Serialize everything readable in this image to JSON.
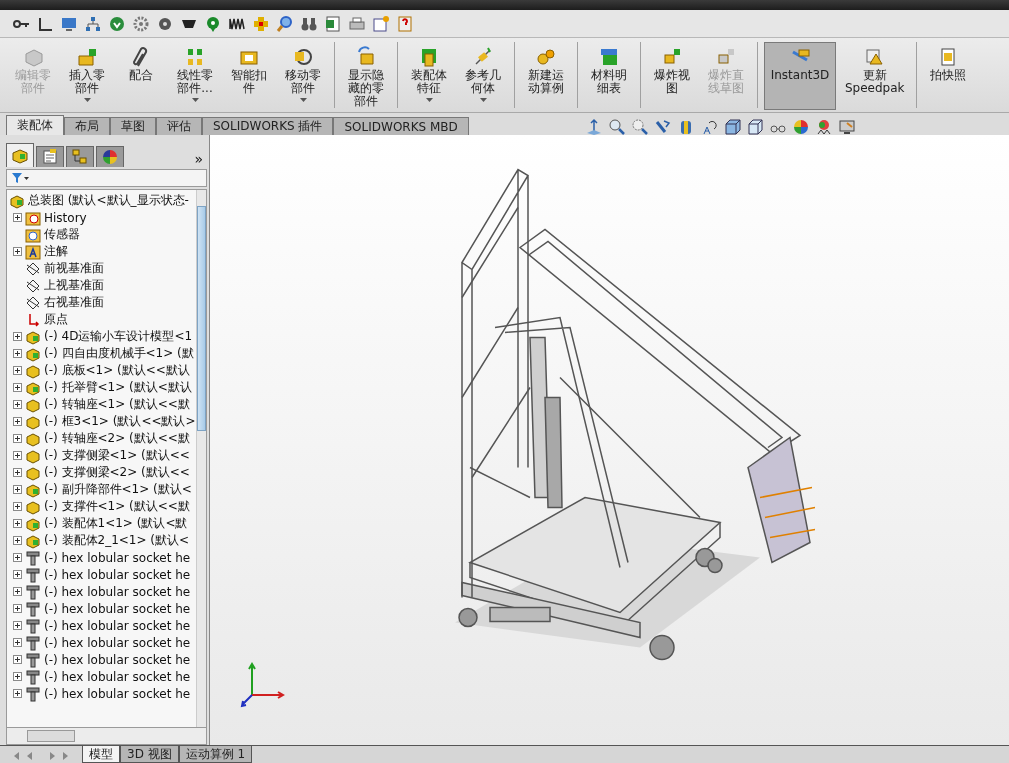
{
  "ribbon": {
    "groups": [
      [
        {
          "label": "编辑零部件",
          "disabled": true,
          "dropdown": false,
          "selected": false
        },
        {
          "label": "插入零部件",
          "disabled": false,
          "dropdown": true,
          "selected": false
        },
        {
          "label": "配合",
          "disabled": false,
          "dropdown": false,
          "selected": false
        },
        {
          "label": "线性零部件...",
          "disabled": false,
          "dropdown": true,
          "selected": false
        },
        {
          "label": "智能扣件",
          "disabled": false,
          "dropdown": false,
          "selected": false
        },
        {
          "label": "移动零部件",
          "disabled": false,
          "dropdown": true,
          "selected": false
        }
      ],
      [
        {
          "label": "显示隐藏的零部件",
          "disabled": false,
          "dropdown": false,
          "selected": false
        }
      ],
      [
        {
          "label": "装配体特征",
          "disabled": false,
          "dropdown": true,
          "selected": false
        },
        {
          "label": "参考几何体",
          "disabled": false,
          "dropdown": true,
          "selected": false
        }
      ],
      [
        {
          "label": "新建运动算例",
          "disabled": false,
          "dropdown": false,
          "selected": false
        }
      ],
      [
        {
          "label": "材料明细表",
          "disabled": false,
          "dropdown": false,
          "selected": false
        }
      ],
      [
        {
          "label": "爆炸视图",
          "disabled": false,
          "dropdown": false,
          "selected": false
        },
        {
          "label": "爆炸直线草图",
          "disabled": true,
          "dropdown": false,
          "selected": false
        }
      ],
      [
        {
          "label": "Instant3D",
          "disabled": false,
          "dropdown": false,
          "selected": true
        },
        {
          "label": "更新 Speedpak",
          "disabled": false,
          "dropdown": false,
          "selected": false
        }
      ],
      [
        {
          "label": "拍快照",
          "disabled": false,
          "dropdown": false,
          "selected": false
        }
      ]
    ]
  },
  "tabs": [
    {
      "label": "装配体",
      "selected": true
    },
    {
      "label": "布局",
      "selected": false
    },
    {
      "label": "草图",
      "selected": false
    },
    {
      "label": "评估",
      "selected": false
    },
    {
      "label": "SOLIDWORKS 插件",
      "selected": false
    },
    {
      "label": "SOLIDWORKS MBD",
      "selected": false
    }
  ],
  "panel": {
    "tabs": [
      {
        "selected": true
      },
      {
        "selected": false
      },
      {
        "selected": false
      },
      {
        "selected": false
      }
    ],
    "more": "»"
  },
  "tree": {
    "root": {
      "label": "总装图 (默认<默认_显示状态-",
      "kind": "assembly",
      "children": [
        {
          "label": "History",
          "kind": "history",
          "expanded": false
        },
        {
          "label": "传感器",
          "kind": "sensor"
        },
        {
          "label": "注解",
          "kind": "annotation",
          "expanded": false
        },
        {
          "label": "前视基准面",
          "kind": "plane"
        },
        {
          "label": "上视基准面",
          "kind": "plane"
        },
        {
          "label": "右视基准面",
          "kind": "plane"
        },
        {
          "label": "原点",
          "kind": "origin"
        },
        {
          "label": "(-) 4D运输小车设计模型<1",
          "kind": "assembly",
          "expanded": false
        },
        {
          "label": "(-) 四自由度机械手<1> (默",
          "kind": "assembly",
          "expanded": false
        },
        {
          "label": "(-) 底板<1> (默认<<默认",
          "kind": "part",
          "expanded": false
        },
        {
          "label": "(-) 托举臂<1> (默认<默认",
          "kind": "assembly",
          "expanded": false
        },
        {
          "label": "(-) 转轴座<1> (默认<<默",
          "kind": "part",
          "expanded": false
        },
        {
          "label": "(-) 框3<1> (默认<<默认>",
          "kind": "part",
          "expanded": false
        },
        {
          "label": "(-) 转轴座<2> (默认<<默",
          "kind": "part",
          "expanded": false
        },
        {
          "label": "(-) 支撑侧梁<1> (默认<<",
          "kind": "part",
          "expanded": false
        },
        {
          "label": "(-) 支撑侧梁<2> (默认<<",
          "kind": "part",
          "expanded": false
        },
        {
          "label": "(-) 副升降部件<1> (默认<",
          "kind": "assembly",
          "expanded": false
        },
        {
          "label": "(-) 支撑件<1> (默认<<默",
          "kind": "part",
          "expanded": false
        },
        {
          "label": "(-) 装配体1<1> (默认<默",
          "kind": "assembly",
          "expanded": false
        },
        {
          "label": "(-) 装配体2_1<1> (默认<",
          "kind": "assembly",
          "expanded": false
        },
        {
          "label": "(-) hex lobular socket he",
          "kind": "screw",
          "expanded": false
        },
        {
          "label": "(-) hex lobular socket he",
          "kind": "screw",
          "expanded": false
        },
        {
          "label": "(-) hex lobular socket he",
          "kind": "screw",
          "expanded": false
        },
        {
          "label": "(-) hex lobular socket he",
          "kind": "screw",
          "expanded": false
        },
        {
          "label": "(-) hex lobular socket he",
          "kind": "screw",
          "expanded": false
        },
        {
          "label": "(-) hex lobular socket he",
          "kind": "screw",
          "expanded": false
        },
        {
          "label": "(-) hex lobular socket he",
          "kind": "screw",
          "expanded": false
        },
        {
          "label": "(-) hex lobular socket he",
          "kind": "screw",
          "expanded": false
        },
        {
          "label": "(-) hex lobular socket he",
          "kind": "screw",
          "expanded": false
        }
      ]
    }
  },
  "bottom_tabs": [
    {
      "label": "模型",
      "selected": true
    },
    {
      "label": "3D 视图",
      "selected": false
    },
    {
      "label": "运动算例 1",
      "selected": false
    }
  ]
}
